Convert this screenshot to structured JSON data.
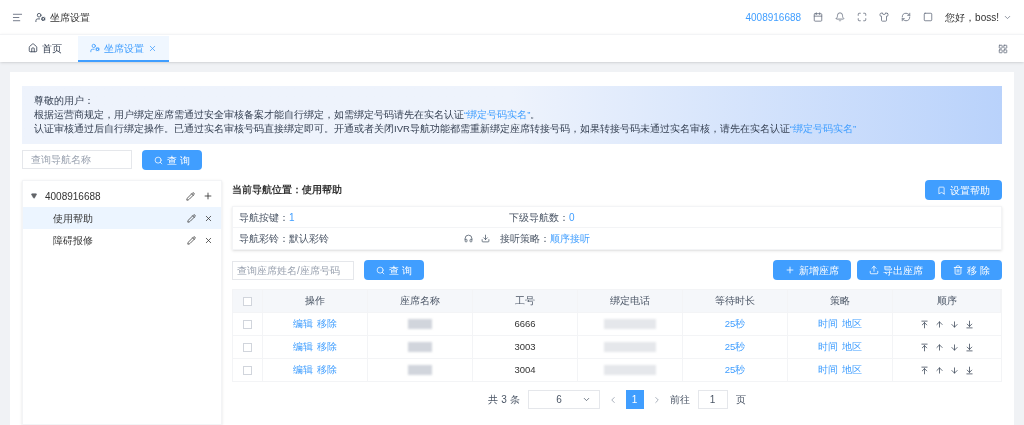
{
  "header": {
    "title": "坐席设置",
    "phone": "4008916688",
    "greeting": "您好，boss!"
  },
  "tabs": [
    {
      "label": "首页",
      "selected": false,
      "kind": "home"
    },
    {
      "label": "坐席设置",
      "selected": true,
      "kind": "page"
    }
  ],
  "notice": {
    "greeting": "尊敬的用户：",
    "lines": [
      {
        "text": "根据运营商规定，用户绑定座席需通过安全审核备案才能自行绑定，如需绑定号码请先在实名认证",
        "link": "“绑定号码实名”",
        "after": "。"
      },
      {
        "text": "认证审核通过后自行绑定操作。已通过实名审核号码直接绑定即可。开通或者关闭IVR导航功能都需重新绑定座席转接号码，如果转接号码未通过实名审核，请先在实名认证",
        "link": "“绑定号码实名”"
      }
    ]
  },
  "nav_search": {
    "placeholder": "查询导航名称",
    "button": "查 询"
  },
  "tree": [
    {
      "label": "4008916688",
      "expanded": true,
      "selected": false,
      "children": [
        {
          "label": "使用帮助",
          "selected": true
        },
        {
          "label": "障碍报修",
          "selected": false
        }
      ]
    }
  ],
  "detail": {
    "location_label": "当前导航位置：",
    "location": "使用帮助",
    "help_button": "设置帮助",
    "nav_key_label": "导航按键：",
    "nav_key": "1",
    "sub_count_label": "下级导航数：",
    "sub_count": "0",
    "ringtone_label": "导航彩铃：",
    "ringtone": "默认彩铃",
    "strategy_label": "接听策略：",
    "strategy": "顺序接听"
  },
  "seat_search": {
    "placeholder": "查询座席姓名/座席号码",
    "button": "查 询"
  },
  "seat_actions": [
    {
      "label": "新增座席",
      "kind": "add"
    },
    {
      "label": "导出座席",
      "kind": "export"
    },
    {
      "label": "移 除",
      "kind": "delete"
    }
  ],
  "table": {
    "all_checked": false,
    "columns": [
      "操作",
      "座席名称",
      "工号",
      "绑定电话",
      "等待时长",
      "策略",
      "顺序"
    ],
    "rows": [
      {
        "checked": false,
        "actions": [
          "编辑",
          "移除"
        ],
        "job_no": "6666",
        "wait": "25秒",
        "strategy": [
          "时间",
          "地区"
        ]
      },
      {
        "checked": false,
        "actions": [
          "编辑",
          "移除"
        ],
        "job_no": "3003",
        "wait": "25秒",
        "strategy": [
          "时间",
          "地区"
        ]
      },
      {
        "checked": false,
        "actions": [
          "编辑",
          "移除"
        ],
        "job_no": "3004",
        "wait": "25秒",
        "strategy": [
          "时间",
          "地区"
        ]
      }
    ]
  },
  "pagination": {
    "total": "共 3 条",
    "page_size": "6",
    "pages": [
      {
        "label": "1",
        "selected": true
      }
    ],
    "goto_label": "前往",
    "goto_value": "1",
    "suffix": "页"
  }
}
